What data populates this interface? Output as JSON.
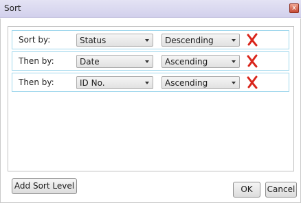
{
  "window": {
    "title": "Sort",
    "close_glyph": "x"
  },
  "levels": [
    {
      "label": "Sort by:",
      "field": "Status",
      "order": "Descending"
    },
    {
      "label": "Then by:",
      "field": "Date",
      "order": "Ascending"
    },
    {
      "label": "Then by:",
      "field": "ID No.",
      "order": "Ascending"
    }
  ],
  "icons": {
    "delete": "delete-x-icon",
    "dropdown": "chevron-down-icon"
  },
  "colors": {
    "titlebar": "#d8d6ee",
    "row_border": "#9fd7ec",
    "delete_red": "#d9261c"
  },
  "buttons": {
    "add_level": "Add Sort Level",
    "ok": "OK",
    "cancel": "Cancel"
  }
}
